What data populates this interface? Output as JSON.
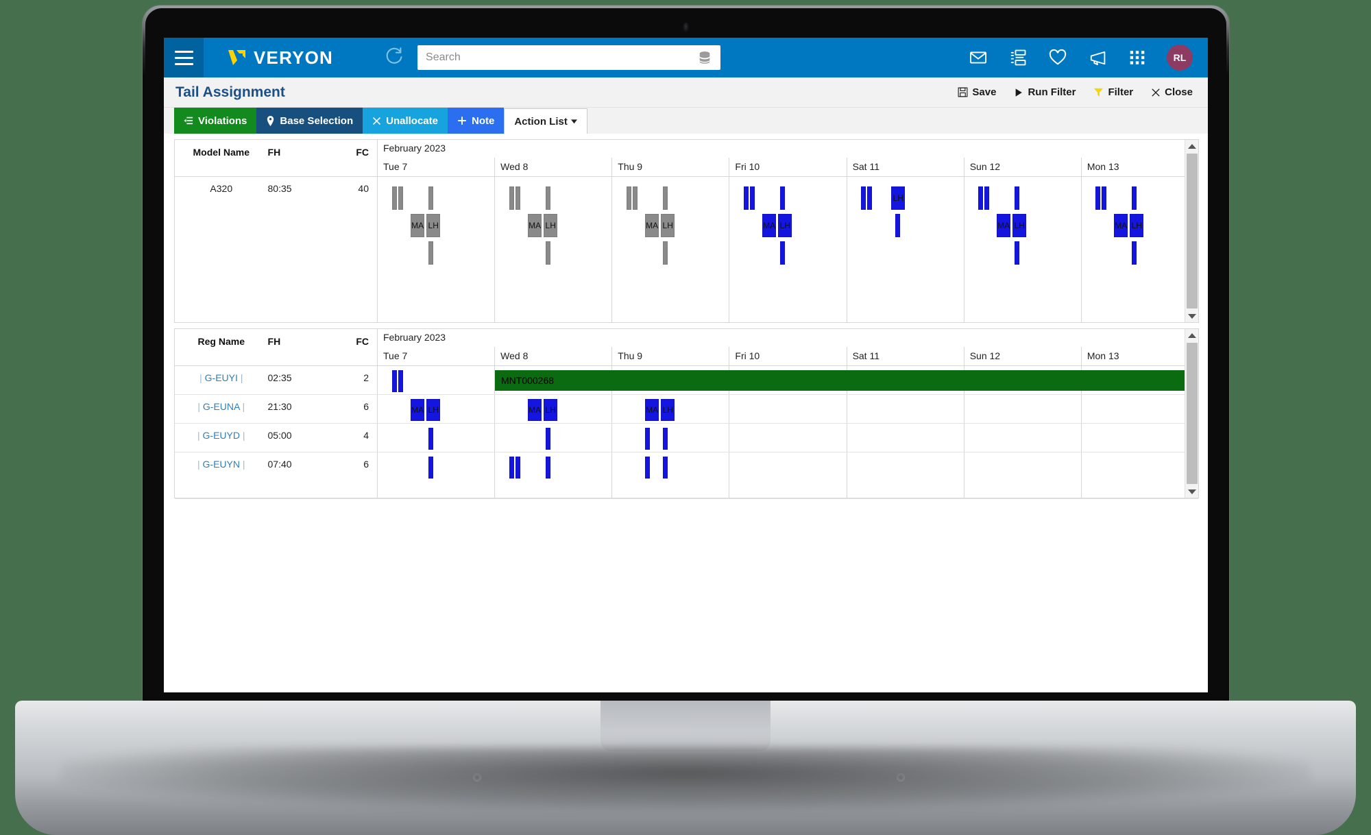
{
  "app": {
    "brand": "VERYON",
    "menu_icon": "hamburger-icon",
    "refresh_icon": "refresh-icon",
    "avatar_initials": "RL",
    "accent_blue": "#0078c1",
    "page_background": "#46704d"
  },
  "search": {
    "placeholder": "Search",
    "value": "",
    "db_icon": "database-icon"
  },
  "top_icons": [
    {
      "name": "mail-icon",
      "label": "Mail"
    },
    {
      "name": "tasks-icon",
      "label": "Tasks"
    },
    {
      "name": "heart-icon",
      "label": "Favorites"
    },
    {
      "name": "megaphone-icon",
      "label": "Announcements"
    },
    {
      "name": "apps-grid-icon",
      "label": "Apps"
    }
  ],
  "page": {
    "title": "Tail Assignment",
    "actions": [
      {
        "label": "Save",
        "icon": "save-icon"
      },
      {
        "label": "Run Filter",
        "icon": "play-icon"
      },
      {
        "label": "Filter",
        "icon": "funnel-icon"
      },
      {
        "label": "Close",
        "icon": "close-icon"
      }
    ]
  },
  "toolbar": [
    {
      "label": "Violations",
      "icon": "violations-icon",
      "color": "#138a1d"
    },
    {
      "label": "Base Selection",
      "icon": "map-pin-icon",
      "color": "#17507f"
    },
    {
      "label": "Unallocate",
      "icon": "x-icon",
      "color": "#17a3dd"
    },
    {
      "label": "Note",
      "icon": "plus-icon",
      "color": "#2c6ef0"
    },
    {
      "label": "Action List",
      "icon": "caret-down-icon",
      "color": "#ffffff"
    }
  ],
  "grid_top": {
    "columns": [
      "Model Name",
      "FH",
      "FC"
    ],
    "month": "February 2023",
    "days": [
      "Tue 7",
      "Wed 8",
      "Thu 9",
      "Fri 10",
      "Sat 11",
      "Sun 12",
      "Mon 13"
    ],
    "rows": [
      {
        "model_name": "A320",
        "fh": "80:35",
        "fc": "40"
      }
    ],
    "chart_data": {
      "type": "bar",
      "title": "Tail assignment gantt — model A320",
      "xlabel": "February 2023",
      "ylabel": "",
      "day_columns": [
        "Tue 7",
        "Wed 8",
        "Thu 9",
        "Fri 10",
        "Sat 11",
        "Sun 12",
        "Mon 13"
      ],
      "lanes": 3,
      "bars": [
        {
          "day": 0,
          "lane": 0,
          "left_pct": 12,
          "width_pct": 4.2,
          "label": "",
          "color": "#8a8a8a"
        },
        {
          "day": 0,
          "lane": 0,
          "left_pct": 17.5,
          "width_pct": 4.2,
          "label": "",
          "color": "#8a8a8a"
        },
        {
          "day": 0,
          "lane": 0,
          "left_pct": 43,
          "width_pct": 4.2,
          "label": "",
          "color": "#8a8a8a"
        },
        {
          "day": 0,
          "lane": 1,
          "left_pct": 28,
          "width_pct": 12,
          "label": "MA",
          "color": "#8a8a8a"
        },
        {
          "day": 0,
          "lane": 1,
          "left_pct": 41.5,
          "width_pct": 12,
          "label": "LH",
          "color": "#8a8a8a"
        },
        {
          "day": 0,
          "lane": 2,
          "left_pct": 43,
          "width_pct": 4.2,
          "label": "",
          "color": "#8a8a8a"
        },
        {
          "day": 1,
          "lane": 0,
          "left_pct": 12,
          "width_pct": 4.2,
          "label": "",
          "color": "#8a8a8a"
        },
        {
          "day": 1,
          "lane": 0,
          "left_pct": 17.5,
          "width_pct": 4.2,
          "label": "",
          "color": "#8a8a8a"
        },
        {
          "day": 1,
          "lane": 0,
          "left_pct": 43,
          "width_pct": 4.2,
          "label": "",
          "color": "#8a8a8a"
        },
        {
          "day": 1,
          "lane": 1,
          "left_pct": 28,
          "width_pct": 12,
          "label": "MA",
          "color": "#8a8a8a"
        },
        {
          "day": 1,
          "lane": 1,
          "left_pct": 41.5,
          "width_pct": 12,
          "label": "LH",
          "color": "#8a8a8a"
        },
        {
          "day": 1,
          "lane": 2,
          "left_pct": 43,
          "width_pct": 4.2,
          "label": "",
          "color": "#8a8a8a"
        },
        {
          "day": 2,
          "lane": 0,
          "left_pct": 12,
          "width_pct": 4.2,
          "label": "",
          "color": "#8a8a8a"
        },
        {
          "day": 2,
          "lane": 0,
          "left_pct": 17.5,
          "width_pct": 4.2,
          "label": "",
          "color": "#8a8a8a"
        },
        {
          "day": 2,
          "lane": 0,
          "left_pct": 43,
          "width_pct": 4.2,
          "label": "",
          "color": "#8a8a8a"
        },
        {
          "day": 2,
          "lane": 1,
          "left_pct": 28,
          "width_pct": 12,
          "label": "MA",
          "color": "#8a8a8a"
        },
        {
          "day": 2,
          "lane": 1,
          "left_pct": 41.5,
          "width_pct": 12,
          "label": "LH",
          "color": "#8a8a8a"
        },
        {
          "day": 2,
          "lane": 2,
          "left_pct": 43,
          "width_pct": 4.2,
          "label": "",
          "color": "#8a8a8a"
        },
        {
          "day": 3,
          "lane": 0,
          "left_pct": 12,
          "width_pct": 4.2,
          "label": "",
          "color": "#1515e0"
        },
        {
          "day": 3,
          "lane": 0,
          "left_pct": 17.5,
          "width_pct": 4.2,
          "label": "",
          "color": "#1515e0"
        },
        {
          "day": 3,
          "lane": 0,
          "left_pct": 43,
          "width_pct": 4.2,
          "label": "",
          "color": "#1515e0"
        },
        {
          "day": 3,
          "lane": 1,
          "left_pct": 28,
          "width_pct": 12,
          "label": "MA",
          "color": "#1515e0"
        },
        {
          "day": 3,
          "lane": 1,
          "left_pct": 41.5,
          "width_pct": 12,
          "label": "LH",
          "color": "#1515e0"
        },
        {
          "day": 3,
          "lane": 2,
          "left_pct": 43,
          "width_pct": 4.2,
          "label": "",
          "color": "#1515e0"
        },
        {
          "day": 4,
          "lane": 0,
          "left_pct": 12,
          "width_pct": 4.2,
          "label": "",
          "color": "#1515e0"
        },
        {
          "day": 4,
          "lane": 0,
          "left_pct": 17.5,
          "width_pct": 4.2,
          "label": "",
          "color": "#1515e0"
        },
        {
          "day": 4,
          "lane": 0,
          "left_pct": 38,
          "width_pct": 12,
          "label": "LH",
          "color": "#1515e0"
        },
        {
          "day": 4,
          "lane": 1,
          "left_pct": 41.5,
          "width_pct": 4.2,
          "label": "",
          "color": "#1515e0"
        },
        {
          "day": 5,
          "lane": 0,
          "left_pct": 12,
          "width_pct": 4.2,
          "label": "",
          "color": "#1515e0"
        },
        {
          "day": 5,
          "lane": 0,
          "left_pct": 17.5,
          "width_pct": 4.2,
          "label": "",
          "color": "#1515e0"
        },
        {
          "day": 5,
          "lane": 0,
          "left_pct": 43,
          "width_pct": 4.2,
          "label": "",
          "color": "#1515e0"
        },
        {
          "day": 5,
          "lane": 1,
          "left_pct": 28,
          "width_pct": 12,
          "label": "MA",
          "color": "#1515e0"
        },
        {
          "day": 5,
          "lane": 1,
          "left_pct": 41.5,
          "width_pct": 12,
          "label": "LH",
          "color": "#1515e0"
        },
        {
          "day": 5,
          "lane": 2,
          "left_pct": 43,
          "width_pct": 4.2,
          "label": "",
          "color": "#1515e0"
        },
        {
          "day": 6,
          "lane": 0,
          "left_pct": 12,
          "width_pct": 4.2,
          "label": "",
          "color": "#1515e0"
        },
        {
          "day": 6,
          "lane": 0,
          "left_pct": 17.5,
          "width_pct": 4.2,
          "label": "",
          "color": "#1515e0"
        },
        {
          "day": 6,
          "lane": 0,
          "left_pct": 43,
          "width_pct": 4.2,
          "label": "",
          "color": "#1515e0"
        },
        {
          "day": 6,
          "lane": 1,
          "left_pct": 28,
          "width_pct": 12,
          "label": "MA",
          "color": "#1515e0"
        },
        {
          "day": 6,
          "lane": 1,
          "left_pct": 41.5,
          "width_pct": 12,
          "label": "LH",
          "color": "#1515e0"
        },
        {
          "day": 6,
          "lane": 2,
          "left_pct": 43,
          "width_pct": 4.2,
          "label": "",
          "color": "#1515e0"
        }
      ]
    }
  },
  "grid_bottom": {
    "columns": [
      "Reg Name",
      "FH",
      "FC"
    ],
    "month": "February 2023",
    "days": [
      "Tue 7",
      "Wed 8",
      "Thu 9",
      "Fri 10",
      "Sat 11",
      "Sun 12",
      "Mon 13"
    ],
    "rows": [
      {
        "reg_name": "G-EUYI",
        "fh": "02:35",
        "fc": "2"
      },
      {
        "reg_name": "G-EUNA",
        "fh": "21:30",
        "fc": "6"
      },
      {
        "reg_name": "G-EUYD",
        "fh": "05:00",
        "fc": "4"
      },
      {
        "reg_name": "G-EUYN",
        "fh": "07:40",
        "fc": "6"
      }
    ],
    "chart_data": {
      "type": "bar",
      "title": "Tail assignment gantt — registrations",
      "xlabel": "February 2023",
      "day_columns": [
        "Tue 7",
        "Wed 8",
        "Thu 9",
        "Fri 10",
        "Sat 11",
        "Sun 12",
        "Mon 13"
      ],
      "bars": [
        {
          "row": 0,
          "day": 0,
          "left_pct": 12,
          "width_pct": 4.2,
          "label": "",
          "color": "#1515e0"
        },
        {
          "row": 0,
          "day": 0,
          "left_pct": 17.5,
          "width_pct": 4.2,
          "label": "",
          "color": "#1515e0"
        },
        {
          "row": 0,
          "day": 1,
          "left_pct": 0,
          "span_days": 6,
          "width_pct": 600,
          "label": "MNT000268",
          "color": "#0a6b11"
        },
        {
          "row": 1,
          "day": 0,
          "left_pct": 28,
          "width_pct": 12,
          "label": "MA",
          "color": "#1515e0"
        },
        {
          "row": 1,
          "day": 0,
          "left_pct": 41.5,
          "width_pct": 12,
          "label": "LH",
          "color": "#1515e0"
        },
        {
          "row": 1,
          "day": 1,
          "left_pct": 28,
          "width_pct": 12,
          "label": "MA",
          "color": "#1515e0"
        },
        {
          "row": 1,
          "day": 1,
          "left_pct": 41.5,
          "width_pct": 12,
          "label": "LH",
          "color": "#1515e0"
        },
        {
          "row": 1,
          "day": 2,
          "left_pct": 28,
          "width_pct": 12,
          "label": "MA",
          "color": "#1515e0"
        },
        {
          "row": 1,
          "day": 2,
          "left_pct": 41.5,
          "width_pct": 12,
          "label": "LH",
          "color": "#1515e0"
        },
        {
          "row": 2,
          "day": 0,
          "left_pct": 43,
          "width_pct": 4.2,
          "label": "",
          "color": "#1515e0"
        },
        {
          "row": 2,
          "day": 1,
          "left_pct": 43,
          "width_pct": 4.2,
          "label": "",
          "color": "#1515e0"
        },
        {
          "row": 2,
          "day": 2,
          "left_pct": 28,
          "width_pct": 4.2,
          "label": "",
          "color": "#1515e0"
        },
        {
          "row": 2,
          "day": 2,
          "left_pct": 43,
          "width_pct": 4.2,
          "label": "",
          "color": "#1515e0"
        },
        {
          "row": 3,
          "day": 0,
          "left_pct": 43,
          "width_pct": 4.2,
          "label": "",
          "color": "#1515e0"
        },
        {
          "row": 3,
          "day": 1,
          "left_pct": 12,
          "width_pct": 4.2,
          "label": "",
          "color": "#1515e0"
        },
        {
          "row": 3,
          "day": 1,
          "left_pct": 17.5,
          "width_pct": 4.2,
          "label": "",
          "color": "#1515e0"
        },
        {
          "row": 3,
          "day": 1,
          "left_pct": 43,
          "width_pct": 4.2,
          "label": "",
          "color": "#1515e0"
        },
        {
          "row": 3,
          "day": 2,
          "left_pct": 28,
          "width_pct": 4.2,
          "label": "",
          "color": "#1515e0"
        },
        {
          "row": 3,
          "day": 2,
          "left_pct": 43,
          "width_pct": 4.2,
          "label": "",
          "color": "#1515e0"
        }
      ]
    }
  }
}
